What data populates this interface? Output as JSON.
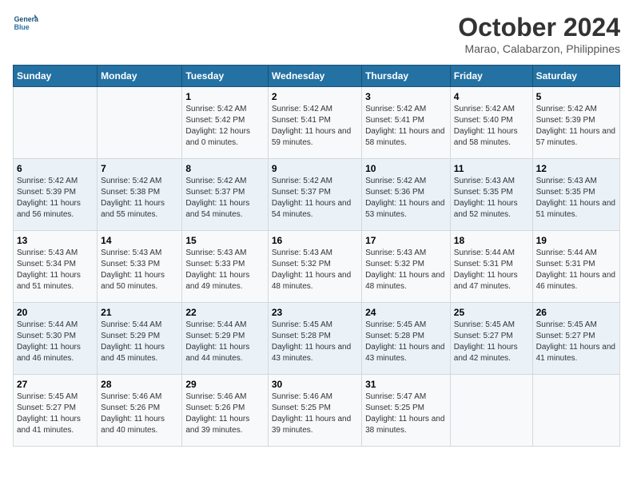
{
  "header": {
    "logo_line1": "General",
    "logo_line2": "Blue",
    "month": "October 2024",
    "location": "Marao, Calabarzon, Philippines"
  },
  "days_of_week": [
    "Sunday",
    "Monday",
    "Tuesday",
    "Wednesday",
    "Thursday",
    "Friday",
    "Saturday"
  ],
  "weeks": [
    [
      {
        "day": "",
        "sunrise": "",
        "sunset": "",
        "daylight": ""
      },
      {
        "day": "",
        "sunrise": "",
        "sunset": "",
        "daylight": ""
      },
      {
        "day": "1",
        "sunrise": "Sunrise: 5:42 AM",
        "sunset": "Sunset: 5:42 PM",
        "daylight": "Daylight: 12 hours and 0 minutes."
      },
      {
        "day": "2",
        "sunrise": "Sunrise: 5:42 AM",
        "sunset": "Sunset: 5:41 PM",
        "daylight": "Daylight: 11 hours and 59 minutes."
      },
      {
        "day": "3",
        "sunrise": "Sunrise: 5:42 AM",
        "sunset": "Sunset: 5:41 PM",
        "daylight": "Daylight: 11 hours and 58 minutes."
      },
      {
        "day": "4",
        "sunrise": "Sunrise: 5:42 AM",
        "sunset": "Sunset: 5:40 PM",
        "daylight": "Daylight: 11 hours and 58 minutes."
      },
      {
        "day": "5",
        "sunrise": "Sunrise: 5:42 AM",
        "sunset": "Sunset: 5:39 PM",
        "daylight": "Daylight: 11 hours and 57 minutes."
      }
    ],
    [
      {
        "day": "6",
        "sunrise": "Sunrise: 5:42 AM",
        "sunset": "Sunset: 5:39 PM",
        "daylight": "Daylight: 11 hours and 56 minutes."
      },
      {
        "day": "7",
        "sunrise": "Sunrise: 5:42 AM",
        "sunset": "Sunset: 5:38 PM",
        "daylight": "Daylight: 11 hours and 55 minutes."
      },
      {
        "day": "8",
        "sunrise": "Sunrise: 5:42 AM",
        "sunset": "Sunset: 5:37 PM",
        "daylight": "Daylight: 11 hours and 54 minutes."
      },
      {
        "day": "9",
        "sunrise": "Sunrise: 5:42 AM",
        "sunset": "Sunset: 5:37 PM",
        "daylight": "Daylight: 11 hours and 54 minutes."
      },
      {
        "day": "10",
        "sunrise": "Sunrise: 5:42 AM",
        "sunset": "Sunset: 5:36 PM",
        "daylight": "Daylight: 11 hours and 53 minutes."
      },
      {
        "day": "11",
        "sunrise": "Sunrise: 5:43 AM",
        "sunset": "Sunset: 5:35 PM",
        "daylight": "Daylight: 11 hours and 52 minutes."
      },
      {
        "day": "12",
        "sunrise": "Sunrise: 5:43 AM",
        "sunset": "Sunset: 5:35 PM",
        "daylight": "Daylight: 11 hours and 51 minutes."
      }
    ],
    [
      {
        "day": "13",
        "sunrise": "Sunrise: 5:43 AM",
        "sunset": "Sunset: 5:34 PM",
        "daylight": "Daylight: 11 hours and 51 minutes."
      },
      {
        "day": "14",
        "sunrise": "Sunrise: 5:43 AM",
        "sunset": "Sunset: 5:33 PM",
        "daylight": "Daylight: 11 hours and 50 minutes."
      },
      {
        "day": "15",
        "sunrise": "Sunrise: 5:43 AM",
        "sunset": "Sunset: 5:33 PM",
        "daylight": "Daylight: 11 hours and 49 minutes."
      },
      {
        "day": "16",
        "sunrise": "Sunrise: 5:43 AM",
        "sunset": "Sunset: 5:32 PM",
        "daylight": "Daylight: 11 hours and 48 minutes."
      },
      {
        "day": "17",
        "sunrise": "Sunrise: 5:43 AM",
        "sunset": "Sunset: 5:32 PM",
        "daylight": "Daylight: 11 hours and 48 minutes."
      },
      {
        "day": "18",
        "sunrise": "Sunrise: 5:44 AM",
        "sunset": "Sunset: 5:31 PM",
        "daylight": "Daylight: 11 hours and 47 minutes."
      },
      {
        "day": "19",
        "sunrise": "Sunrise: 5:44 AM",
        "sunset": "Sunset: 5:31 PM",
        "daylight": "Daylight: 11 hours and 46 minutes."
      }
    ],
    [
      {
        "day": "20",
        "sunrise": "Sunrise: 5:44 AM",
        "sunset": "Sunset: 5:30 PM",
        "daylight": "Daylight: 11 hours and 46 minutes."
      },
      {
        "day": "21",
        "sunrise": "Sunrise: 5:44 AM",
        "sunset": "Sunset: 5:29 PM",
        "daylight": "Daylight: 11 hours and 45 minutes."
      },
      {
        "day": "22",
        "sunrise": "Sunrise: 5:44 AM",
        "sunset": "Sunset: 5:29 PM",
        "daylight": "Daylight: 11 hours and 44 minutes."
      },
      {
        "day": "23",
        "sunrise": "Sunrise: 5:45 AM",
        "sunset": "Sunset: 5:28 PM",
        "daylight": "Daylight: 11 hours and 43 minutes."
      },
      {
        "day": "24",
        "sunrise": "Sunrise: 5:45 AM",
        "sunset": "Sunset: 5:28 PM",
        "daylight": "Daylight: 11 hours and 43 minutes."
      },
      {
        "day": "25",
        "sunrise": "Sunrise: 5:45 AM",
        "sunset": "Sunset: 5:27 PM",
        "daylight": "Daylight: 11 hours and 42 minutes."
      },
      {
        "day": "26",
        "sunrise": "Sunrise: 5:45 AM",
        "sunset": "Sunset: 5:27 PM",
        "daylight": "Daylight: 11 hours and 41 minutes."
      }
    ],
    [
      {
        "day": "27",
        "sunrise": "Sunrise: 5:45 AM",
        "sunset": "Sunset: 5:27 PM",
        "daylight": "Daylight: 11 hours and 41 minutes."
      },
      {
        "day": "28",
        "sunrise": "Sunrise: 5:46 AM",
        "sunset": "Sunset: 5:26 PM",
        "daylight": "Daylight: 11 hours and 40 minutes."
      },
      {
        "day": "29",
        "sunrise": "Sunrise: 5:46 AM",
        "sunset": "Sunset: 5:26 PM",
        "daylight": "Daylight: 11 hours and 39 minutes."
      },
      {
        "day": "30",
        "sunrise": "Sunrise: 5:46 AM",
        "sunset": "Sunset: 5:25 PM",
        "daylight": "Daylight: 11 hours and 39 minutes."
      },
      {
        "day": "31",
        "sunrise": "Sunrise: 5:47 AM",
        "sunset": "Sunset: 5:25 PM",
        "daylight": "Daylight: 11 hours and 38 minutes."
      },
      {
        "day": "",
        "sunrise": "",
        "sunset": "",
        "daylight": ""
      },
      {
        "day": "",
        "sunrise": "",
        "sunset": "",
        "daylight": ""
      }
    ]
  ]
}
